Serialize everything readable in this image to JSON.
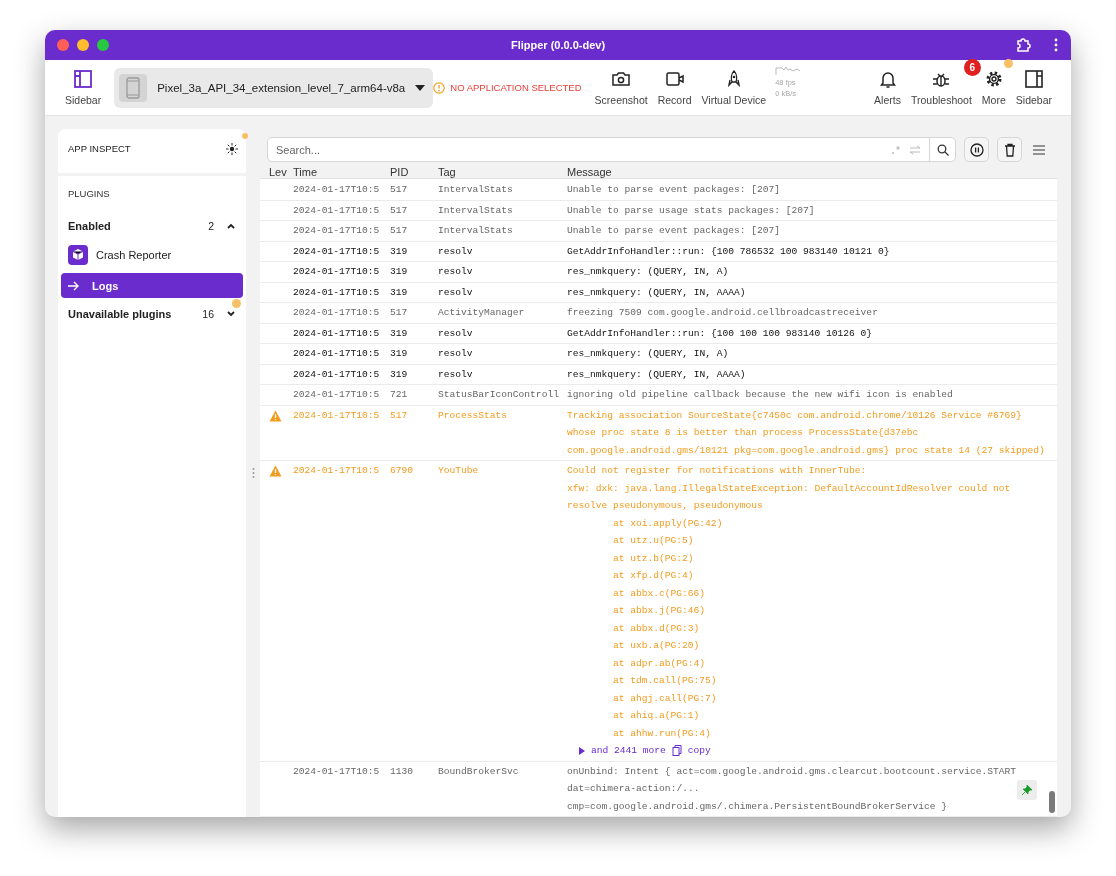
{
  "window": {
    "title": "Flipper (0.0.0-dev)"
  },
  "toolbar": {
    "left_button": "Sidebar",
    "device": "Pixel_3a_API_34_extension_level_7_arm64-v8a",
    "app_status": "NO APPLICATION SELECTED",
    "actions": [
      {
        "label": "Screenshot",
        "kind": "camera"
      },
      {
        "label": "Record",
        "kind": "video"
      },
      {
        "label": "Virtual Device",
        "kind": "rocket"
      }
    ],
    "stats": {
      "fps": "48 fps",
      "rate": "0 kB/s"
    },
    "right_actions": [
      {
        "label": "Alerts",
        "kind": "bell",
        "dot": false
      },
      {
        "label": "Troubleshoot",
        "kind": "bug",
        "badge": "6",
        "dot": false
      },
      {
        "label": "More",
        "kind": "gear",
        "dot": true
      },
      {
        "label": "Sidebar",
        "kind": "sidebar",
        "dot": false
      }
    ]
  },
  "sidebar": {
    "header": "APP INSPECT",
    "header_dot": true,
    "section": "PLUGINS",
    "groups": [
      {
        "label": "Enabled",
        "count": "2",
        "expanded": true,
        "dot": false,
        "items": [
          {
            "label": "Crash Reporter",
            "kind": "crash",
            "selected": false
          },
          {
            "label": "Logs",
            "kind": "logs",
            "selected": true
          }
        ]
      },
      {
        "label": "Unavailable plugins",
        "count": "16",
        "expanded": false,
        "dot": true
      }
    ]
  },
  "logs": {
    "search": {
      "placeholder": "Search..."
    },
    "columns": [
      "Lev",
      "Time",
      "PID",
      "Tag",
      "Message"
    ],
    "rows": [
      {
        "kind": "verbose",
        "time": "2024-01-17T10:5",
        "pid": "517",
        "tag": "IntervalStats",
        "message": [
          "Unable to parse event packages: [207]"
        ],
        "hovered": false
      },
      {
        "kind": "verbose",
        "time": "2024-01-17T10:5",
        "pid": "517",
        "tag": "IntervalStats",
        "message": [
          "Unable to parse usage stats packages: [207]"
        ],
        "hovered": false
      },
      {
        "kind": "verbose",
        "time": "2024-01-17T10:5",
        "pid": "517",
        "tag": "IntervalStats",
        "message": [
          "Unable to parse event packages: [207]"
        ],
        "hovered": false
      },
      {
        "kind": "debug",
        "time": "2024-01-17T10:5",
        "pid": "319",
        "tag": "resolv",
        "message": [
          "GetAddrInfoHandler::run: {100 786532 100 983140 10121 0}"
        ],
        "hovered": false
      },
      {
        "kind": "debug",
        "time": "2024-01-17T10:5",
        "pid": "319",
        "tag": "resolv",
        "message": [
          "res_nmkquery: (QUERY, IN, A)"
        ],
        "hovered": false
      },
      {
        "kind": "debug",
        "time": "2024-01-17T10:5",
        "pid": "319",
        "tag": "resolv",
        "message": [
          "res_nmkquery: (QUERY, IN, AAAA)"
        ],
        "hovered": false
      },
      {
        "kind": "verbose",
        "time": "2024-01-17T10:5",
        "pid": "517",
        "tag": "ActivityManager",
        "message": [
          "freezing 7509 com.google.android.cellbroadcastreceiver"
        ],
        "hovered": false
      },
      {
        "kind": "debug",
        "time": "2024-01-17T10:5",
        "pid": "319",
        "tag": "resolv",
        "message": [
          "GetAddrInfoHandler::run: {100 100 100 983140 10126 0}"
        ],
        "hovered": false
      },
      {
        "kind": "debug",
        "time": "2024-01-17T10:5",
        "pid": "319",
        "tag": "resolv",
        "message": [
          "res_nmkquery: (QUERY, IN, A)"
        ],
        "hovered": false
      },
      {
        "kind": "debug",
        "time": "2024-01-17T10:5",
        "pid": "319",
        "tag": "resolv",
        "message": [
          "res_nmkquery: (QUERY, IN, AAAA)"
        ],
        "hovered": false
      },
      {
        "kind": "verbose",
        "time": "2024-01-17T10:5",
        "pid": "721",
        "tag": "StatusBarIconControll",
        "message": [
          "ignoring old pipeline callback because the new wifi icon is enabled"
        ],
        "hovered": false
      },
      {
        "kind": "warn",
        "time": "2024-01-17T10:5",
        "pid": "517",
        "tag": "ProcessStats",
        "message": [
          "Tracking association SourceState{c7450c com.android.chrome/10126 Service #6769}",
          "whose proc state 8 is better than process ProcessState{d37ebc",
          "com.google.android.gms/10121 pkg=com.google.android.gms} proc state 14 (27 skipped)"
        ],
        "hovered": false
      },
      {
        "kind": "warn",
        "time": "2024-01-17T10:5",
        "pid": "6790",
        "tag": "YouTube",
        "message": [
          "Could not register for notifications with InnerTube:",
          "xfw: dxk: java.lang.IllegalStateException: DefaultAccountIdResolver could not",
          "resolve pseudonymous, pseudonymous"
        ],
        "stack": [
          "at xoi.apply(PG:42)",
          "at utz.u(PG:5)",
          "at utz.b(PG:2)",
          "at xfp.d(PG:4)",
          "at abbx.c(PG:66)",
          "at abbx.j(PG:46)",
          "at abbx.d(PG:3)",
          "at uxb.a(PG:20)",
          "at adpr.ab(PG:4)",
          "at tdm.call(PG:75)",
          "at ahgj.call(PG:7)",
          "at ahiq.a(PG:1)",
          "at ahhw.run(PG:4)"
        ],
        "more": "and 2441 more",
        "copy": "copy",
        "hovered": false
      },
      {
        "kind": "verbose",
        "time": "2024-01-17T10:5",
        "pid": "1130",
        "tag": "BoundBrokerSvc",
        "message": [
          "onUnbind: Intent { act=com.google.android.gms.clearcut.bootcount.service.START",
          "dat=chimera-action:/...",
          "cmp=com.google.android.gms/.chimera.PersistentBoundBrokerService }"
        ],
        "hovered": true
      }
    ]
  }
}
